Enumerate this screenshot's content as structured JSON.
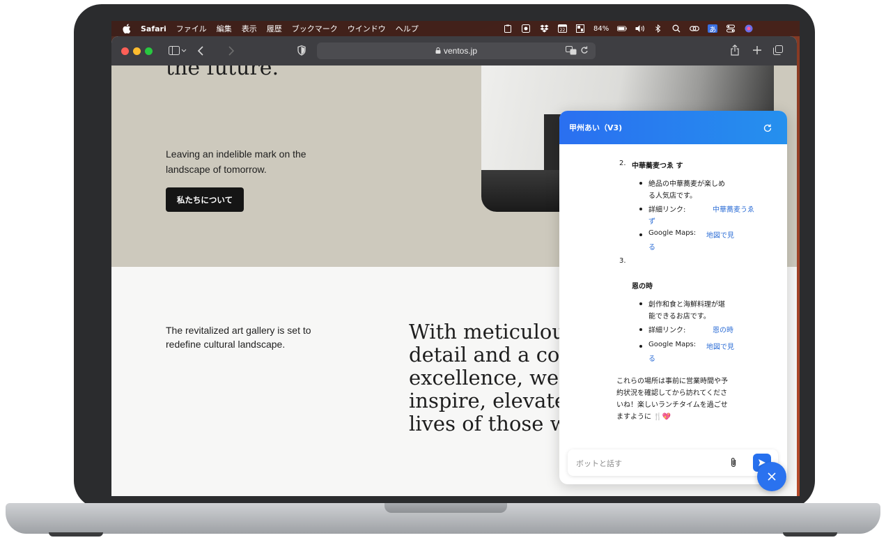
{
  "menubar": {
    "app": "Safari",
    "items": [
      "ファイル",
      "編集",
      "表示",
      "履歴",
      "ブックマーク",
      "ウインドウ",
      "ヘルプ"
    ],
    "battery": "84%",
    "icons": [
      "clipboard-icon",
      "app-icon",
      "dropbox-icon",
      "calendar-icon",
      "screen-icon",
      "battery-icon",
      "volume-icon",
      "bluetooth-icon",
      "search-icon",
      "link-icon",
      "input-method-icon",
      "control-center-icon",
      "siri-icon"
    ],
    "calendar_day": "22",
    "input_method": "あ"
  },
  "browser": {
    "url": "ventos.jp"
  },
  "hero": {
    "title": "the future.",
    "subtitle": "Leaving an indelible mark on the landscape of tomorrow.",
    "button": "私たちについて"
  },
  "section": {
    "left_text": "The revitalized art gallery is set to redefine cultural landscape.",
    "serif_lines": [
      "With meticulou",
      "detail and a con",
      "excellence, we c",
      "inspire, elevate,",
      "lives of those w"
    ]
  },
  "chat": {
    "title": "甲州あい（V3)",
    "item2_number": "2.",
    "item2_name": "中華蕎麦つゑ す",
    "item2_desc_1": "絶品の中華蕎麦が楽しめ",
    "item2_desc_2": "る人気店です。",
    "detail_label": "詳細リンク: ",
    "item2_link_1": "中華蕎麦うゑ",
    "item2_link_2": "ず",
    "maps_label": "Google Maps: ",
    "maps_link_1": "地図で見",
    "maps_link_2": "る",
    "item3_number": "3.",
    "item3_name": "恩の時",
    "item3_desc_1": "創作和食と海鮮料理が堪",
    "item3_desc_2": "能できるお店です。",
    "item3_link": "恩の時",
    "closing_1": "これらの場所は事前に営業時間や予",
    "closing_2": "約状況を確認してから訪れてくださ",
    "closing_3": "いね！楽しいランチタイムを過ごせ",
    "closing_4": "ますように 🍴💖",
    "input_placeholder": "ボットと話す"
  },
  "colors": {
    "hero_bg": "#cdc9bd",
    "chat_header": "#2a6ff0",
    "link": "#2f6fd6",
    "button_dark": "#151515"
  }
}
